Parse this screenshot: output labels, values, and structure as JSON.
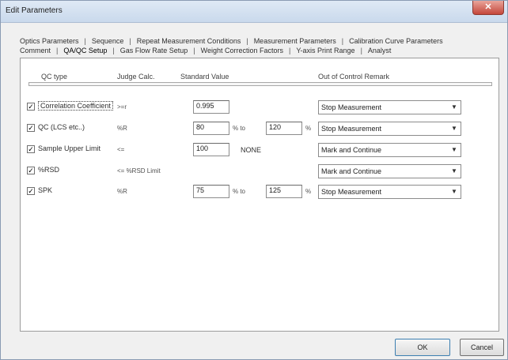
{
  "window": {
    "title": "Edit Parameters",
    "close_glyph": "✕"
  },
  "tabs": {
    "row1": [
      "Optics Parameters",
      "Sequence",
      "Repeat Measurement Conditions",
      "Measurement Parameters",
      "Calibration Curve Parameters"
    ],
    "row2": [
      "Comment",
      "QA/QC Setup",
      "Gas Flow Rate Setup",
      "Weight Correction Factors",
      "Y-axis Print Range",
      "Analyst"
    ],
    "active": "QA/QC Setup",
    "separator": "|"
  },
  "columns": {
    "qc_type": "QC type",
    "judge_calc": "Judge Calc.",
    "standard_value": "Standard Value",
    "out_of_control": "Out of Control Remark"
  },
  "checkbox_glyph": "✓",
  "dropdown_glyph": "▼",
  "rows": [
    {
      "label": "Correlation Coefficient",
      "checked": true,
      "judge": ">=r",
      "value1": "0.995",
      "action": "Stop Measurement"
    },
    {
      "label": "QC (LCS etc..)",
      "checked": true,
      "judge": "%R",
      "value1": "80",
      "unit1": "% to",
      "value2": "120",
      "unit2": "%",
      "action": "Stop Measurement"
    },
    {
      "label": "Sample Upper Limit",
      "checked": true,
      "judge": "<=",
      "value1": "100",
      "extra": "NONE",
      "action": "Mark and Continue"
    },
    {
      "label": "%RSD",
      "checked": true,
      "judge": "<= %RSD Limit",
      "action": "Mark and Continue"
    },
    {
      "label": "SPK",
      "checked": true,
      "judge": "%R",
      "value1": "75",
      "unit1": "% to",
      "value2": "125",
      "unit2": "%",
      "action": "Stop Measurement"
    }
  ],
  "buttons": {
    "ok": "OK",
    "cancel": "Cancel"
  }
}
